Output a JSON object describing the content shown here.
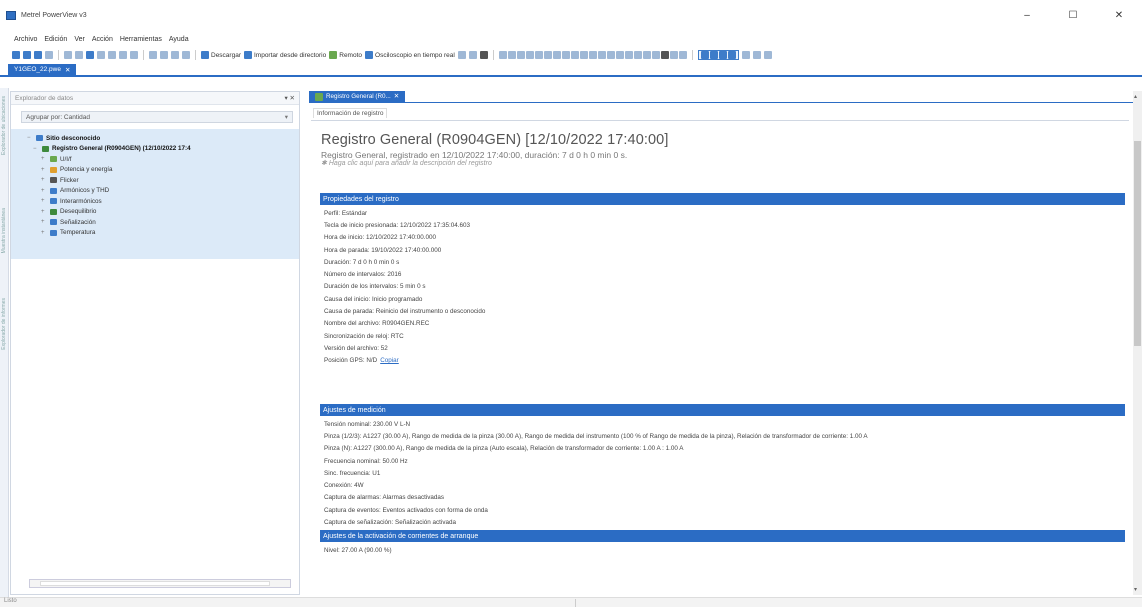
{
  "window": {
    "title": "Metrel PowerView v3",
    "minimize": "–",
    "maximize": "☐",
    "close": "✕"
  },
  "menu": [
    "Archivo",
    "Edición",
    "Ver",
    "Acción",
    "Herramientas",
    "Ayuda"
  ],
  "toolbar": {
    "download": "Descargar",
    "import": "Importar desde directorio",
    "remote": "Remoto",
    "scope": "Osciloscopio en tiempo real"
  },
  "doc_tab": {
    "label": "Y1GEO_22.pwe",
    "close": "✕"
  },
  "explorer": {
    "title": "Explorador de datos",
    "pin": "▾ ✕",
    "group_label": "Agrupar por: Cantidad",
    "group_arrow": "▾",
    "tree": [
      {
        "label": "Sitio desconocido",
        "bold": true,
        "level": 0,
        "exp": "−",
        "color": "#3d7cc9"
      },
      {
        "label": "Registro General (R0904GEN) (12/10/2022 17:4",
        "bold": true,
        "level": 1,
        "exp": "−",
        "color": "#3d8a3d"
      },
      {
        "label": "U/I/f",
        "bold": false,
        "level": 2,
        "exp": "+",
        "color": "#6aa84f"
      },
      {
        "label": "Potencia y energía",
        "bold": false,
        "level": 2,
        "exp": "+",
        "color": "#e0a030"
      },
      {
        "label": "Flicker",
        "bold": false,
        "level": 2,
        "exp": "+",
        "color": "#555555"
      },
      {
        "label": "Armónicos y THD",
        "bold": false,
        "level": 2,
        "exp": "+",
        "color": "#3d7cc9"
      },
      {
        "label": "Interarmónicos",
        "bold": false,
        "level": 2,
        "exp": "+",
        "color": "#3d7cc9"
      },
      {
        "label": "Desequilibrio",
        "bold": false,
        "level": 2,
        "exp": "+",
        "color": "#3d8a3d"
      },
      {
        "label": "Señalización",
        "bold": false,
        "level": 2,
        "exp": "+",
        "color": "#3d7cc9"
      },
      {
        "label": "Temperatura",
        "bold": false,
        "level": 2,
        "exp": "+",
        "color": "#3d7cc9"
      }
    ],
    "strip": [
      "Explorador de ubicaciones",
      "Muestra instantánea",
      "Explorador de informes"
    ]
  },
  "main_tab": {
    "label": "Registro General (R0...",
    "close": "✕"
  },
  "info_tab": "Información de registro",
  "record": {
    "title": "Registro General (R0904GEN) [12/10/2022 17:40:00]",
    "subtitle": "Registro General, registrado en 12/10/2022 17:40:00, duración: 7 d 0 h 0 min 0 s.",
    "note": "Haga clic aquí para añadir la descripción del registro"
  },
  "sections": [
    {
      "title": "Propiedades del registro",
      "rows": [
        "Perfil: Estándar",
        "Tecla de inicio presionada: 12/10/2022 17:35:04.603",
        "Hora de inicio: 12/10/2022 17:40:00.000",
        "Hora de parada: 19/10/2022 17:40:00.000",
        "Duración: 7 d 0 h 0 min 0 s",
        "Número de intervalos: 2016",
        "Duración de los intervalos: 5 min 0 s",
        "Causa del inicio: Inicio programado",
        "Causa de parada: Reinicio del instrumento o desconocido",
        "Nombre del archivo: R0904GEN.REC",
        "Sincronización de reloj: RTC",
        "Versión del archivo: 52",
        "Posición GPS: N/D"
      ],
      "link": "Copiar"
    },
    {
      "title": "Ajustes de medición",
      "rows": [
        "Tensión nominal: 230.00 V L-N",
        "Pinza (1/2/3): A1227 (30.00 A), Rango de medida de la pinza (30.00 A), Rango de medida del instrumento (100 % of Rango de medida de la pinza), Relación de transformador de corriente: 1.00 A",
        "Pinza (N): A1227 (300.00 A), Rango de medida de la pinza (Auto escala), Relación de transformador de corriente: 1.00 A : 1.00 A",
        "Frecuencia nominal: 50.00 Hz",
        "Sinc. frecuencia: U1",
        "Conexión: 4W",
        "Captura de alarmas: Alarmas desactivadas",
        "Captura de eventos: Eventos activados con forma de onda",
        "Captura de señalización: Señalización activada"
      ]
    },
    {
      "title": "Ajustes de la activación de corrientes de arranque",
      "rows": [
        "Nivel: 27.00 A (90.00 %)"
      ]
    }
  ],
  "status": "Listo"
}
